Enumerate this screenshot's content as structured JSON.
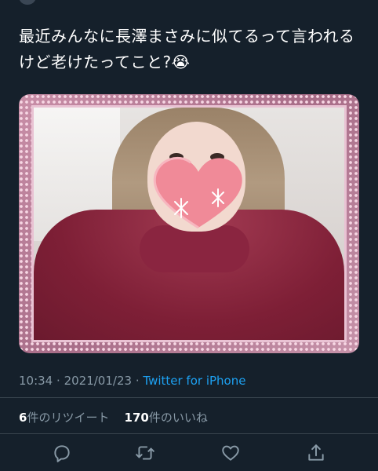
{
  "tweet": {
    "text": "最近みんなに長澤まさみに似てるって言われるけど老けたってこと?😭",
    "time": "10:34",
    "date": "2021/01/23",
    "separator": "·",
    "source": "Twitter for iPhone"
  },
  "stats": {
    "retweets_count": "6",
    "retweets_label": "件のリツイート",
    "likes_count": "170",
    "likes_label": "件のいいね"
  },
  "actions": {
    "icons": [
      "reply-icon",
      "retweet-icon",
      "like-icon",
      "share-icon"
    ]
  },
  "colors": {
    "background": "#15202b",
    "text": "#ffffff",
    "muted": "#8899a6",
    "link": "#1da1f2",
    "divider": "#38444d"
  }
}
